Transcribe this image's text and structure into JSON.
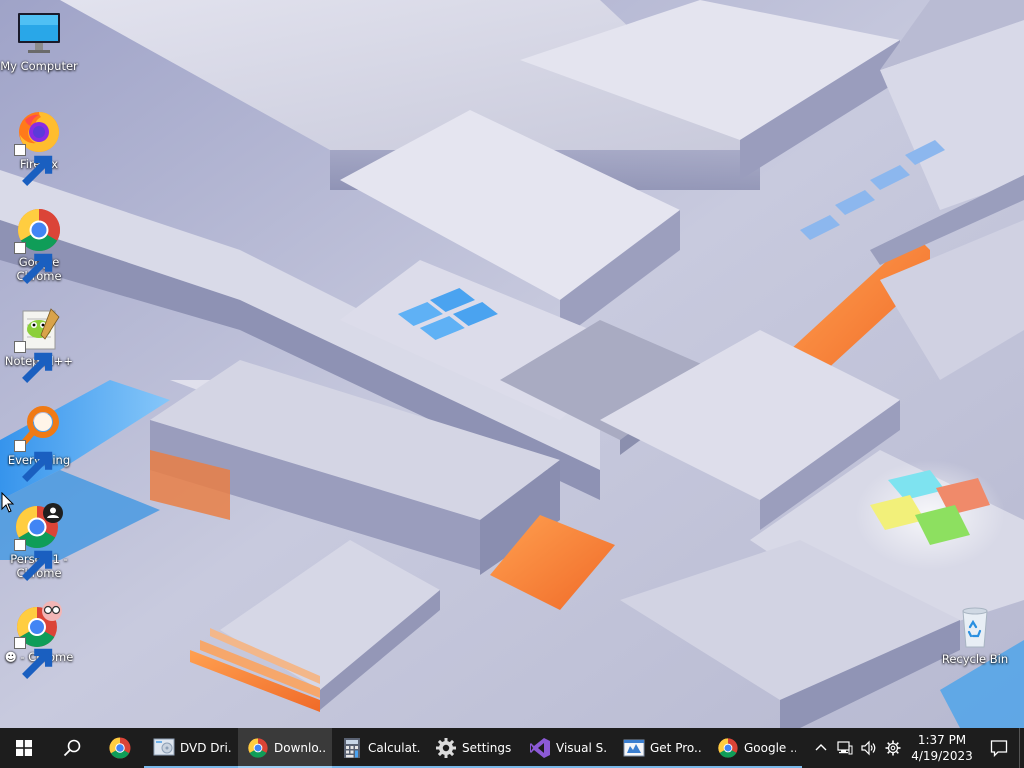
{
  "desktop": {
    "icons": [
      {
        "label": "My Computer",
        "icon": "monitor-icon",
        "shortcut": false
      },
      {
        "label": "Firefox",
        "icon": "firefox-icon",
        "shortcut": true
      },
      {
        "label": "Google Chrome",
        "icon": "chrome-icon",
        "shortcut": true
      },
      {
        "label": "Notepad++",
        "icon": "notepadpp-icon",
        "shortcut": true
      },
      {
        "label": "Everything",
        "icon": "magnifier-icon",
        "shortcut": true
      },
      {
        "label": "Person 1 - Chrome",
        "icon": "chrome-profile-icon",
        "shortcut": true
      },
      {
        "label": "☻ - Chrome",
        "icon": "chrome-glasses-icon",
        "shortcut": true
      },
      {
        "label": "Recycle Bin",
        "icon": "recycle-bin-icon",
        "shortcut": false
      }
    ]
  },
  "taskbar": {
    "start": "windows-start-icon",
    "search": "search-icon",
    "pinned": [
      {
        "icon": "chrome-icon"
      }
    ],
    "items": [
      {
        "label": "DVD Dri...",
        "icon": "dvd-drive-icon",
        "active": false
      },
      {
        "label": "Downlo...",
        "icon": "chrome-icon",
        "active": true
      },
      {
        "label": "Calculat...",
        "icon": "calculator-icon",
        "active": false
      },
      {
        "label": "Settings",
        "icon": "gear-icon",
        "active": false
      },
      {
        "label": "Visual S...",
        "icon": "visual-studio-icon",
        "active": false
      },
      {
        "label": "Get Pro...",
        "icon": "task-window-icon",
        "active": false
      },
      {
        "label": "Google ...",
        "icon": "chrome-icon",
        "active": false
      }
    ],
    "tray": {
      "icons": [
        "chevron-up-icon",
        "network-icon",
        "volume-icon",
        "gear-icon"
      ],
      "time": "1:37 PM",
      "date": "4/19/2023"
    },
    "notifications": "notification-icon"
  },
  "colors": {
    "taskbar": "#1d1d1d",
    "accent": "#7ab8ea",
    "wallpaper_orange": "#f58a3a",
    "wallpaper_blue": "#3aa8f0"
  }
}
